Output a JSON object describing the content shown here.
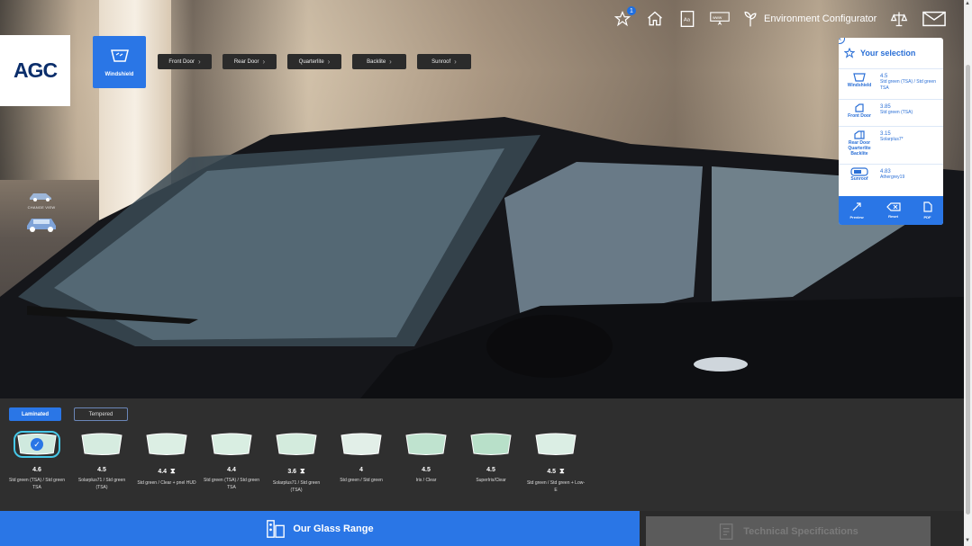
{
  "app": {
    "logo": "AGC"
  },
  "topbar": {
    "notification_count": "1",
    "env_label": "Environment Configurator"
  },
  "parts": {
    "active": "Windshield",
    "tabs": [
      "Front Door",
      "Rear Door",
      "Quarterlite",
      "Backlite",
      "Sunroof"
    ]
  },
  "views": {
    "label": "CHANGE VIEW"
  },
  "selection": {
    "title": "Your selection",
    "rows": [
      {
        "part": "Windshield",
        "value": "4.5",
        "desc": "Std green (TSA) / Std green TSA"
      },
      {
        "part": "Front Door",
        "value": "3.85",
        "desc": "Std green (TSA)"
      },
      {
        "part": "Rear Door Quarterlite Backlite",
        "value": "3.15",
        "desc": "Solarplus7*"
      },
      {
        "part": "Sunroof",
        "value": "4.83",
        "desc": "Athergrey19"
      }
    ],
    "footer": [
      "Preview",
      "Reset",
      "PDF"
    ]
  },
  "filters": {
    "active": "Laminated",
    "inactive": "Tempered"
  },
  "glasses": [
    {
      "value": "4.6",
      "name": "Std green (TSA) / Std green TSA",
      "selected": true,
      "timer": false,
      "tint": "#cfe9de"
    },
    {
      "value": "4.5",
      "name": "Solarplus71 / Std green (TSA)",
      "selected": false,
      "timer": false,
      "tint": "#d6ece0"
    },
    {
      "value": "4.4",
      "name": "Std green / Clear + pnel HUD",
      "selected": false,
      "timer": true,
      "tint": "#dcefe4"
    },
    {
      "value": "4.4",
      "name": "Std green (TSA) / Std green TSA",
      "selected": false,
      "timer": false,
      "tint": "#d9eee2"
    },
    {
      "value": "3.6",
      "name": "Solarplus71 / Std green (TSA)",
      "selected": false,
      "timer": true,
      "tint": "#d3ebdd"
    },
    {
      "value": "4",
      "name": "Std green / Std green",
      "selected": false,
      "timer": false,
      "tint": "#e2efe8"
    },
    {
      "value": "4.5",
      "name": "Iris / Clear",
      "selected": false,
      "timer": false,
      "tint": "#bfe3cf"
    },
    {
      "value": "4.5",
      "name": "SuperIris/Clear",
      "selected": false,
      "timer": false,
      "tint": "#b8e0c9"
    },
    {
      "value": "4.5",
      "name": "Std green / Std green + Low-E",
      "selected": false,
      "timer": true,
      "tint": "#dbeee4"
    }
  ],
  "cta": {
    "primary": "Our Glass Range",
    "secondary": "Technical Specifications"
  }
}
